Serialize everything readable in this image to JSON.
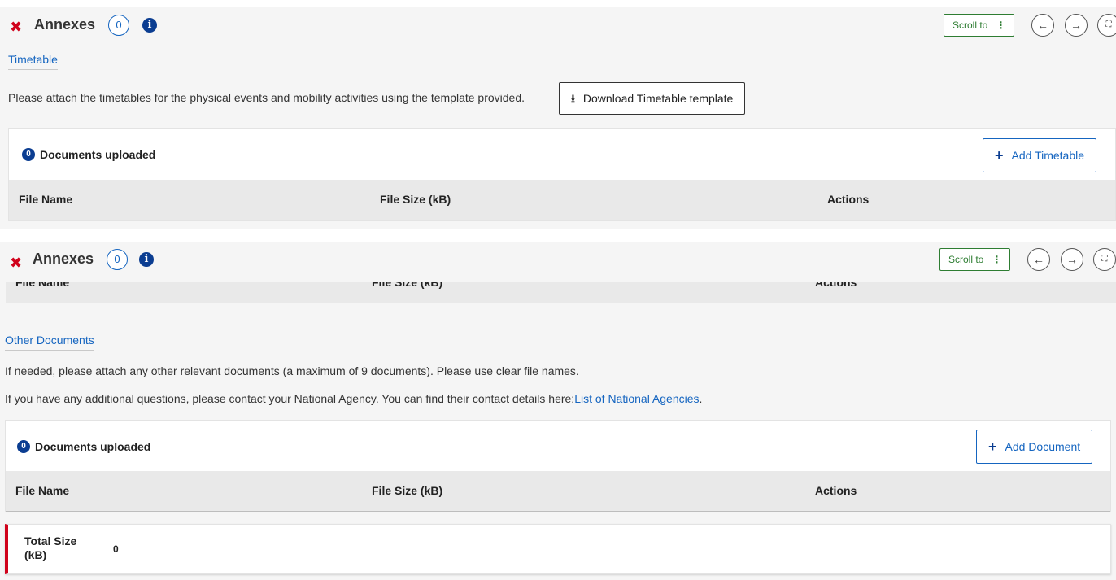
{
  "header": {
    "title": "Annexes",
    "count": "0",
    "info_icon": "info-icon",
    "close_icon": "close-x-icon",
    "scroll_to_label": "Scroll to",
    "scroll_to_menu": "⋮",
    "prev_icon": "←",
    "next_icon": "→",
    "fullscreen_icon": "⛶"
  },
  "timetable": {
    "section_title": "Timetable",
    "description": "Please attach the timetables for the physical events and mobility activities using the template provided.",
    "download_label": "Download Timetable template",
    "documents_count": "0",
    "documents_label": "Documents uploaded",
    "add_label": "Add Timetable",
    "columns": [
      "File Name",
      "File Size (kB)",
      "Actions"
    ]
  },
  "other_documents": {
    "section_title": "Other Documents",
    "description_1": "If needed, please attach any other relevant documents (a maximum of 9 documents). Please use clear file names.",
    "description_2": "If you have any additional questions, please contact your National Agency. You can find their contact details here:",
    "agencies_link": "List of National Agencies",
    "agencies_suffix": ".",
    "documents_count": "0",
    "documents_label": "Documents uploaded",
    "add_label": "Add Document",
    "columns": [
      "File Name",
      "File Size (kB)",
      "Actions"
    ]
  },
  "total": {
    "label": "Total Size (kB)",
    "value": "0"
  },
  "colors": {
    "accent_blue": "#1565c0",
    "navy": "#0b3d91",
    "error_red": "#d0021b",
    "scroll_green": "#2e7d32"
  }
}
